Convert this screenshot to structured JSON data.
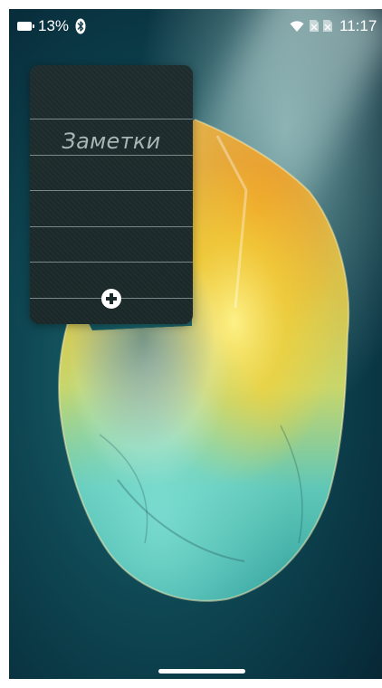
{
  "status_bar": {
    "battery": "13%",
    "time": "11:17",
    "icons": [
      "battery-icon",
      "bluetooth-icon",
      "wifi-icon",
      "sim-icon",
      "sim-icon"
    ]
  },
  "widget": {
    "title": "Заметки",
    "add_icon": "plus-circle-icon"
  },
  "colors": {
    "wallpaper_dark": "#082c3a",
    "wallpaper_teal": "#1d6c72",
    "stone_yellow": "#f2d63a",
    "stone_orange": "#e69a2a",
    "stone_cyan": "#4fc3bd",
    "widget_bg": "#1e2c2d",
    "widget_title": "#aab5b5"
  }
}
